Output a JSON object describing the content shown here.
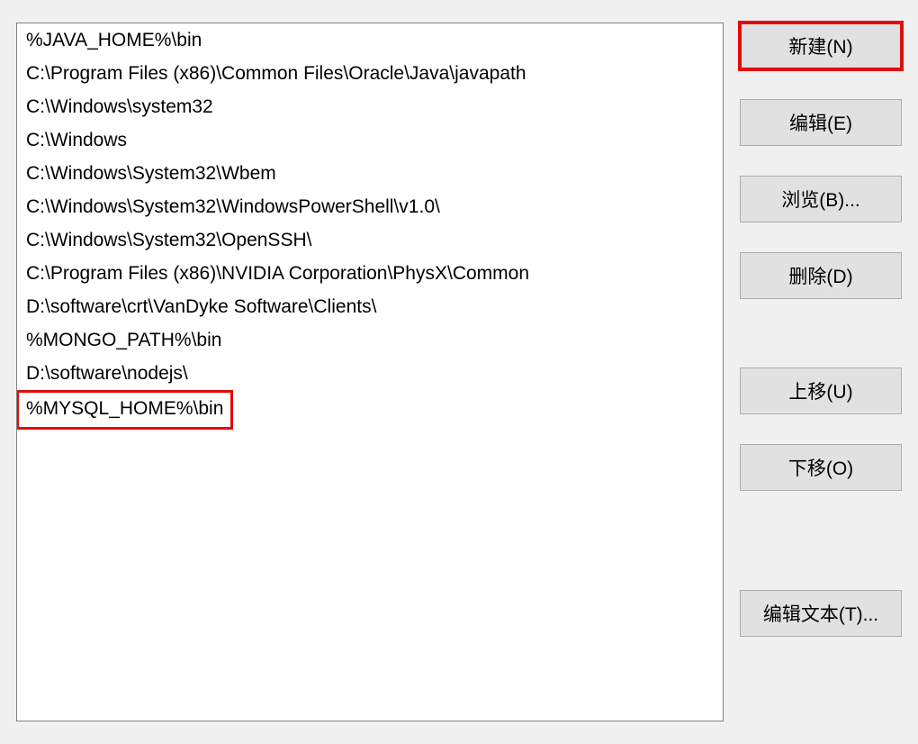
{
  "pathEntries": [
    "%JAVA_HOME%\\bin",
    "C:\\Program Files (x86)\\Common Files\\Oracle\\Java\\javapath",
    "C:\\Windows\\system32",
    "C:\\Windows",
    "C:\\Windows\\System32\\Wbem",
    "C:\\Windows\\System32\\WindowsPowerShell\\v1.0\\",
    "C:\\Windows\\System32\\OpenSSH\\",
    "C:\\Program Files (x86)\\NVIDIA Corporation\\PhysX\\Common",
    "D:\\software\\crt\\VanDyke Software\\Clients\\",
    "%MONGO_PATH%\\bin",
    "D:\\software\\nodejs\\",
    "%MYSQL_HOME%\\bin"
  ],
  "highlightedEntryIndex": 11,
  "buttons": {
    "new": "新建(N)",
    "edit": "编辑(E)",
    "browse": "浏览(B)...",
    "delete": "删除(D)",
    "moveUp": "上移(U)",
    "moveDown": "下移(O)",
    "editText": "编辑文本(T)..."
  },
  "highlightedButton": "new"
}
